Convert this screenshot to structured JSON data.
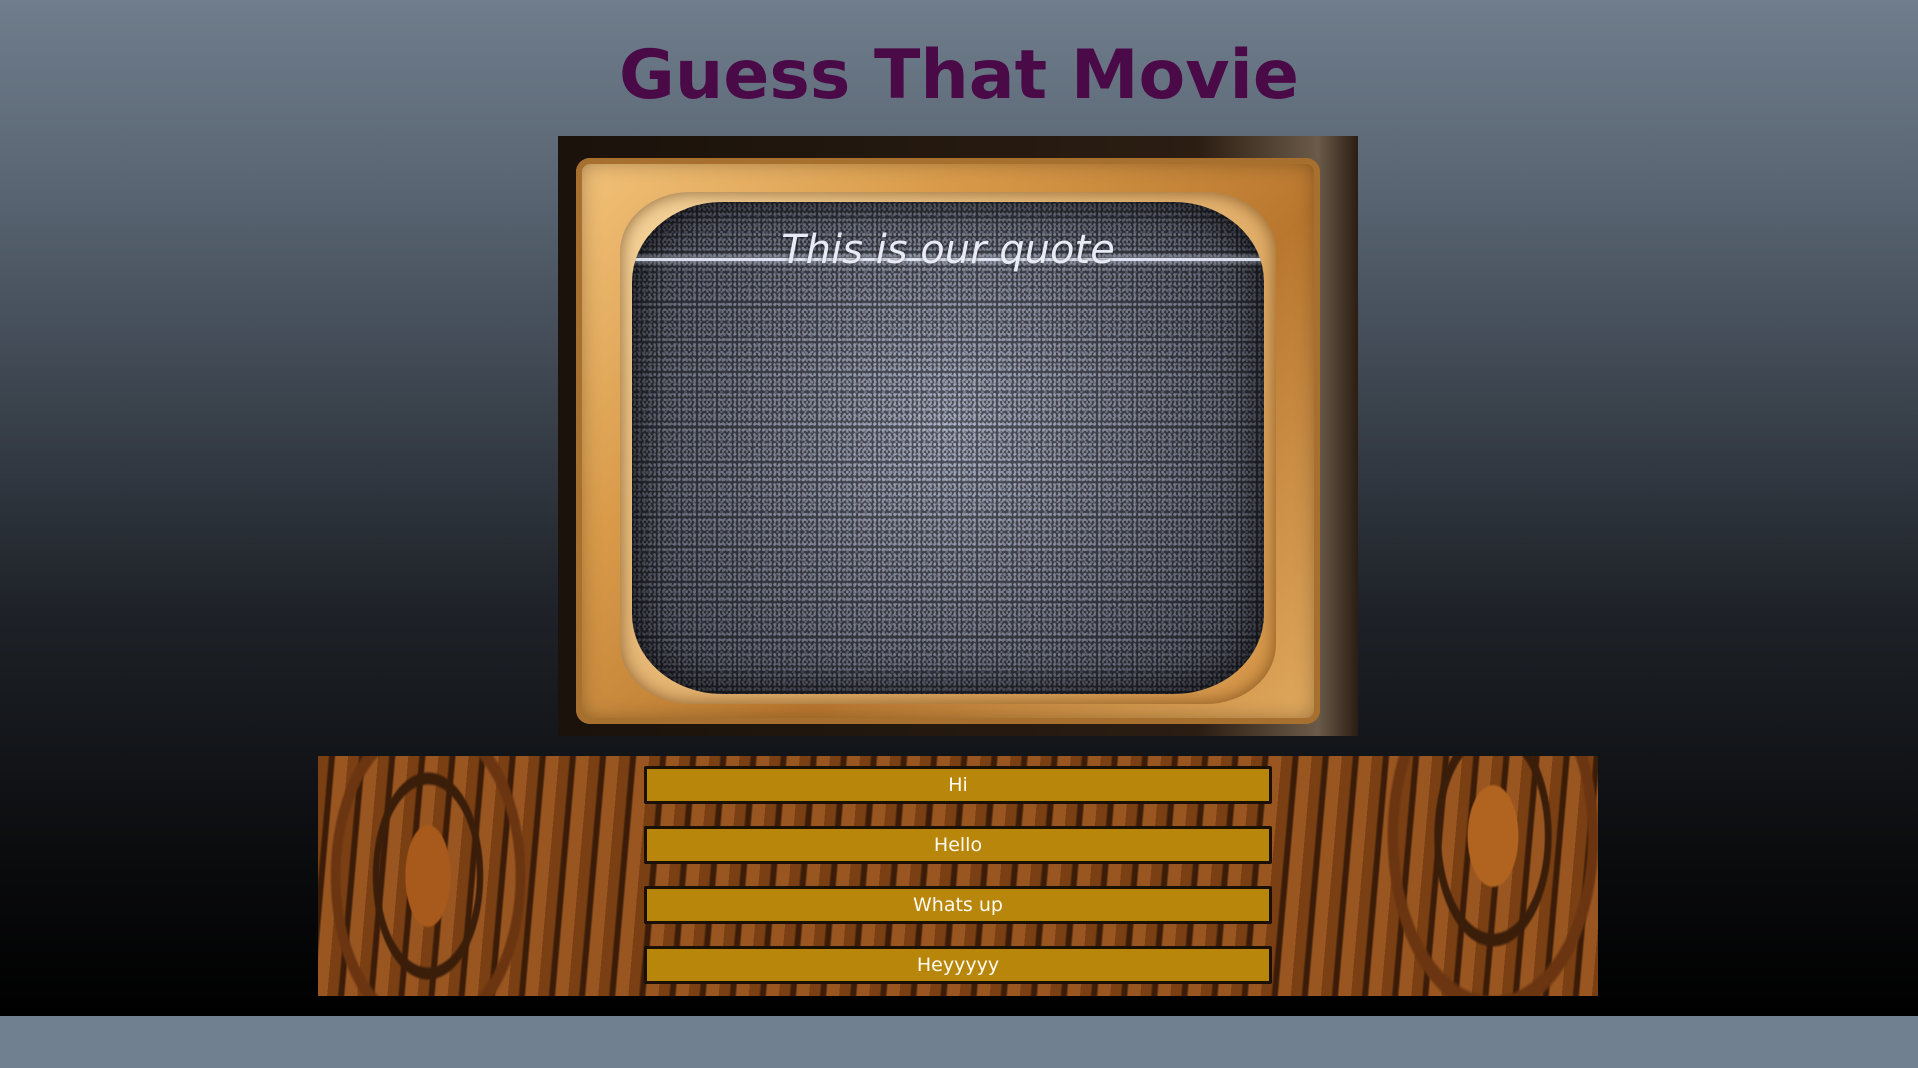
{
  "page": {
    "title": "Guess That Movie"
  },
  "tv": {
    "quote": "This is our quote"
  },
  "answers": [
    {
      "label": "Hi"
    },
    {
      "label": "Hello"
    },
    {
      "label": "Whats up"
    },
    {
      "label": "Heyyyyy"
    }
  ],
  "colors": {
    "title": "#4a0a47",
    "button_bg": "#b8860b",
    "button_border": "#1a1006",
    "button_text": "#fffaf0",
    "footer_band": "#708090"
  }
}
